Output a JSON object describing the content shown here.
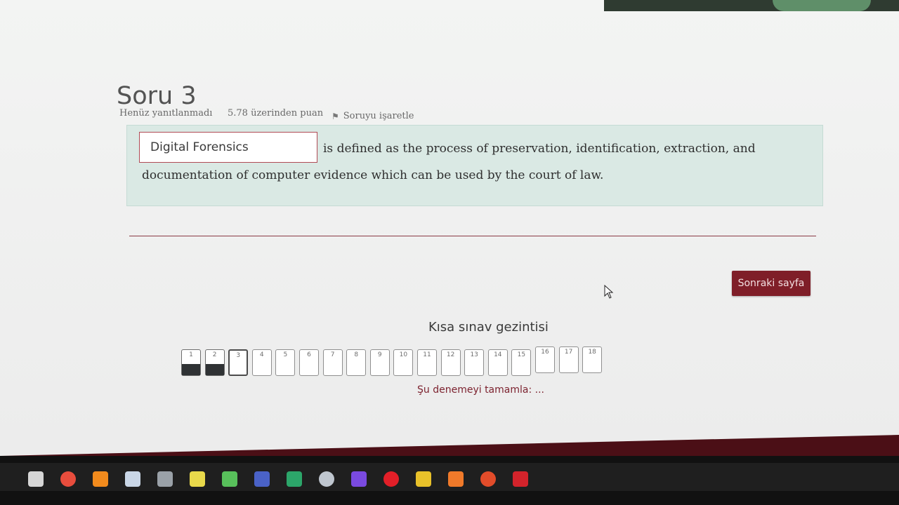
{
  "question": {
    "title": "Soru 3",
    "status": "Henüz yanıtlanmadı",
    "points": "5.78 üzerinden puan",
    "flag_label": "Soruyu işaretle",
    "answer_value": "Digital Forensics",
    "text_line1": "is defined as the process of preservation, identification, extraction, and",
    "text_line2": "documentation of computer evidence which can be used by the court of law."
  },
  "navigation": {
    "next_label": "Sonraki sayfa",
    "title": "Kısa sınav gezintisi",
    "finish_label": "Şu denemeyi tamamla: ...",
    "buttons": [
      {
        "label": "1",
        "state": "answered"
      },
      {
        "label": "2",
        "state": "answered"
      },
      {
        "label": "3",
        "state": "current"
      },
      {
        "label": "4",
        "state": "unanswered"
      },
      {
        "label": "5",
        "state": "unanswered"
      },
      {
        "label": "6",
        "state": "unanswered"
      },
      {
        "label": "7",
        "state": "unanswered"
      },
      {
        "label": "8",
        "state": "unanswered"
      },
      {
        "label": "9",
        "state": "unanswered"
      },
      {
        "label": "10",
        "state": "unanswered"
      },
      {
        "label": "11",
        "state": "unanswered"
      },
      {
        "label": "12",
        "state": "unanswered"
      },
      {
        "label": "13",
        "state": "unanswered"
      },
      {
        "label": "14",
        "state": "unanswered"
      },
      {
        "label": "15",
        "state": "unanswered"
      },
      {
        "label": "16",
        "state": "unanswered"
      },
      {
        "label": "17",
        "state": "unanswered"
      },
      {
        "label": "18",
        "state": "unanswered"
      }
    ]
  },
  "taskbar": {
    "items": [
      {
        "name": "store-icon",
        "color": "#d6d6d6"
      },
      {
        "name": "chrome-icon",
        "color": "#e84d3d"
      },
      {
        "name": "vlc-icon",
        "color": "#f28b1d"
      },
      {
        "name": "steam-icon",
        "color": "#c9d6e6"
      },
      {
        "name": "bc-icon",
        "color": "#9aa1a8"
      },
      {
        "name": "hexagon-app-icon",
        "color": "#e9d94b"
      },
      {
        "name": "green-app-icon",
        "color": "#58c05b"
      },
      {
        "name": "bar-app-icon",
        "color": "#4a62c7"
      },
      {
        "name": "whatsapp-icon",
        "color": "#2ca66a"
      },
      {
        "name": "circle-app-icon",
        "color": "#bfc6cf"
      },
      {
        "name": "visual-studio-icon",
        "color": "#7a4ae0"
      },
      {
        "name": "opera-icon",
        "color": "#e21f28"
      },
      {
        "name": "yellow-app-icon",
        "color": "#e8c12a"
      },
      {
        "name": "matlab-icon",
        "color": "#f07a2a"
      },
      {
        "name": "red-app-icon",
        "color": "#e24c2a"
      },
      {
        "name": "acrobat-icon",
        "color": "#d3232b"
      }
    ]
  }
}
